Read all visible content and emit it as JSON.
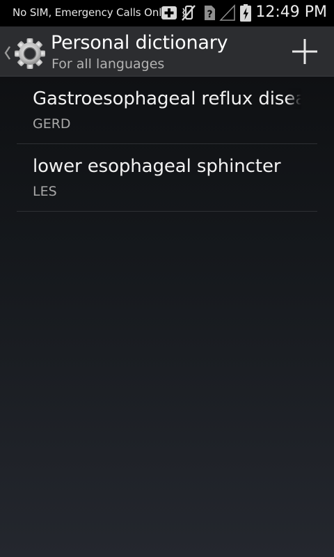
{
  "status_bar": {
    "carrier_text": "No SIM, Emergency Calls Only",
    "time": "12:49 PM",
    "icons": [
      "add-box-icon",
      "vibrate-off-icon",
      "no-sim-icon",
      "signal-icon",
      "battery-charging-icon"
    ]
  },
  "action_bar": {
    "title": "Personal dictionary",
    "subtitle": "For all languages",
    "icons": [
      "up-caret-icon",
      "settings-gear-icon",
      "add-icon"
    ]
  },
  "dictionary": {
    "entries": [
      {
        "word": "Gastroesophageal reflux disease",
        "shortcut": "GERD"
      },
      {
        "word": "lower esophageal sphincter",
        "shortcut": "LES"
      }
    ]
  },
  "colors": {
    "status_bar_bg": "#000000",
    "action_bar_bg": "#2c2d30",
    "primary_text": "#ffffff",
    "secondary_text": "#a8a8a8"
  }
}
